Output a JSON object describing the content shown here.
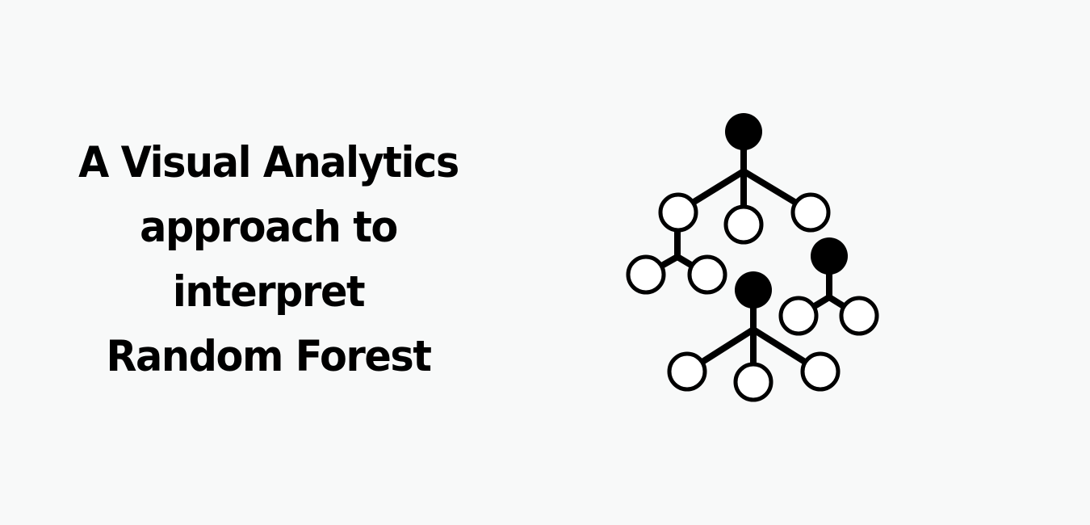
{
  "title": {
    "lines": [
      "A Visual Analytics",
      "approach to",
      "interpret",
      "Random Forest"
    ]
  },
  "illustration": {
    "icon": "random-forest-trees-icon",
    "stroke_color": "#000000",
    "node_fill": "#ffffff",
    "root_fill": "#000000"
  }
}
